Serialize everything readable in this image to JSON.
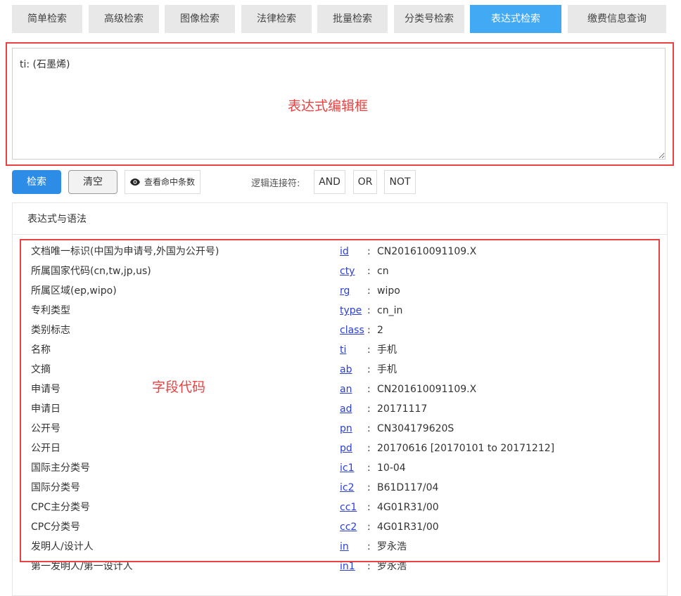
{
  "tabs": [
    {
      "label": "简单检索",
      "active": false
    },
    {
      "label": "高级检索",
      "active": false
    },
    {
      "label": "图像检索",
      "active": false
    },
    {
      "label": "法律检索",
      "active": false
    },
    {
      "label": "批量检索",
      "active": false
    },
    {
      "label": "分类号检索",
      "active": false
    },
    {
      "label": "表达式检索",
      "active": true
    },
    {
      "label": "缴费信息查询",
      "active": false
    }
  ],
  "editor": {
    "value": "ti: (石墨烯)"
  },
  "annotations": {
    "editor": "表达式编辑框",
    "fields": "字段代码"
  },
  "toolbar": {
    "search_label": "检索",
    "clear_label": "清空",
    "hits_label": "查看命中条数",
    "logic_label": "逻辑连接符:",
    "and_label": "AND",
    "or_label": "OR",
    "not_label": "NOT"
  },
  "panel": {
    "title": "表达式与语法"
  },
  "fields": [
    {
      "label": "文档唯一标识(中国为申请号,外国为公开号)",
      "code": "id",
      "value": "CN201610091109.X"
    },
    {
      "label": "所属国家代码(cn,tw,jp,us)",
      "code": "cty",
      "value": "cn"
    },
    {
      "label": "所属区域(ep,wipo)",
      "code": "rg",
      "value": "wipo"
    },
    {
      "label": "专利类型",
      "code": "type",
      "value": "cn_in"
    },
    {
      "label": "类别标志",
      "code": "class",
      "value": "2"
    },
    {
      "label": "名称",
      "code": "ti",
      "value": "手机"
    },
    {
      "label": "文摘",
      "code": "ab",
      "value": "手机"
    },
    {
      "label": "申请号",
      "code": "an",
      "value": "CN201610091109.X"
    },
    {
      "label": "申请日",
      "code": "ad",
      "value": "20171117"
    },
    {
      "label": "公开号",
      "code": "pn",
      "value": "CN304179620S"
    },
    {
      "label": "公开日",
      "code": "pd",
      "value": "20170616 [20170101 to 20171212]"
    },
    {
      "label": "国际主分类号",
      "code": "ic1",
      "value": "10-04"
    },
    {
      "label": "国际分类号",
      "code": "ic2",
      "value": "B61D117/04"
    },
    {
      "label": "CPC主分类号",
      "code": "cc1",
      "value": "4G01R31/00"
    },
    {
      "label": "CPC分类号",
      "code": "cc2",
      "value": "4G01R31/00"
    },
    {
      "label": "发明人/设计人",
      "code": "in",
      "value": "罗永浩"
    },
    {
      "label": "第一发明人/第一设计人",
      "code": "in1",
      "value": "罗永浩"
    }
  ]
}
